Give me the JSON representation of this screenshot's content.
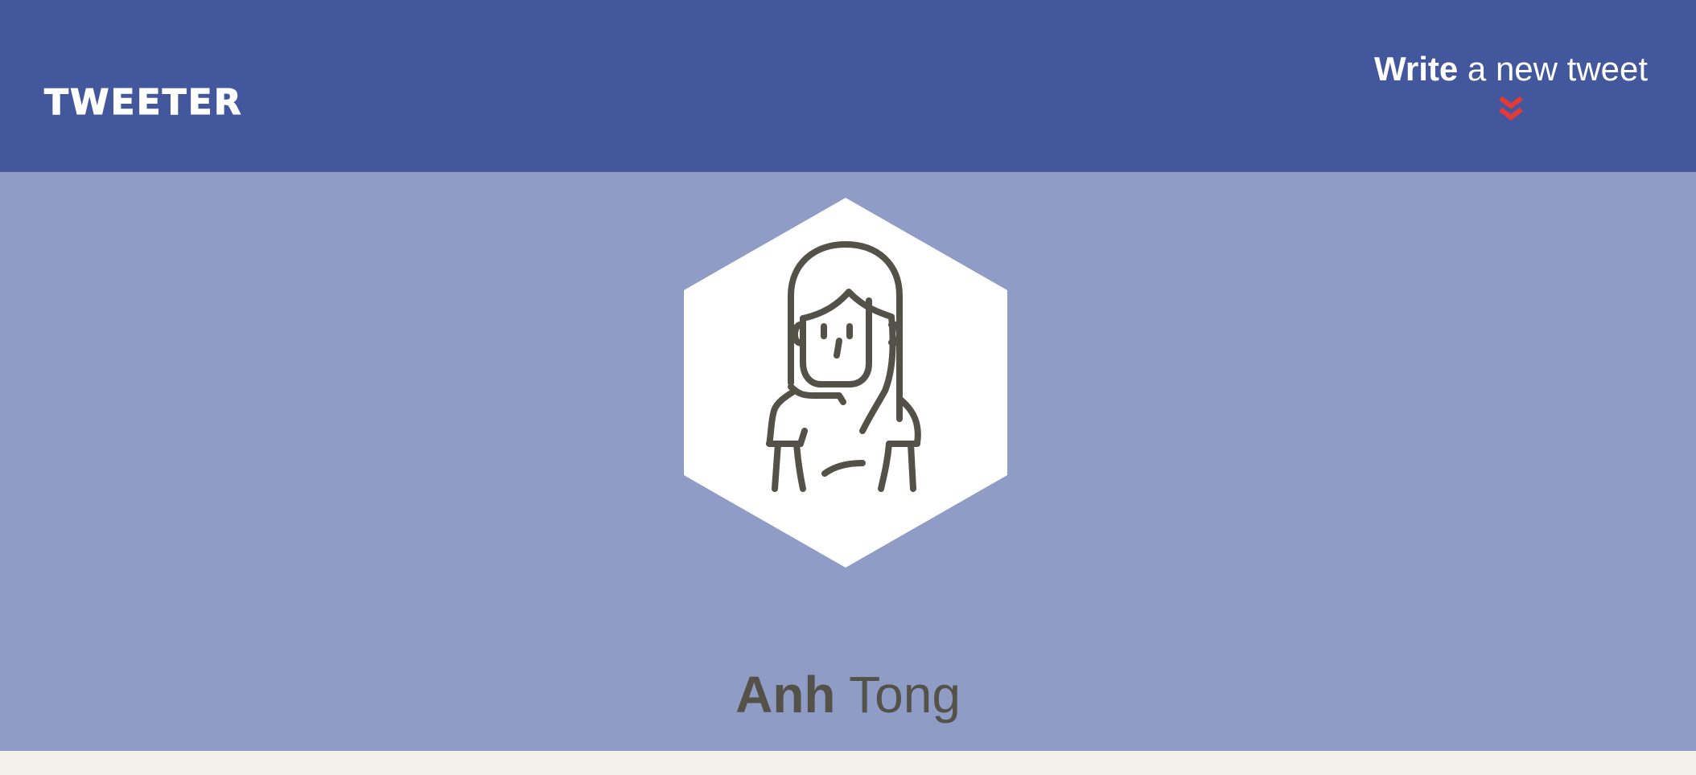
{
  "colors": {
    "nav_bg": "#43579d",
    "profile_bg": "#8f9cc6",
    "accent_arrow": "#e53935",
    "name_text": "#545149",
    "page_bg": "#f2f0eb"
  },
  "nav": {
    "logo": "TWEETER",
    "compose": {
      "strong": "Write",
      "light": "a new tweet",
      "icon": "double-chevron-down-icon"
    }
  },
  "profile": {
    "avatar_icon": "woman-avatar-icon",
    "first_name": "Anh",
    "last_name": "Tong"
  }
}
